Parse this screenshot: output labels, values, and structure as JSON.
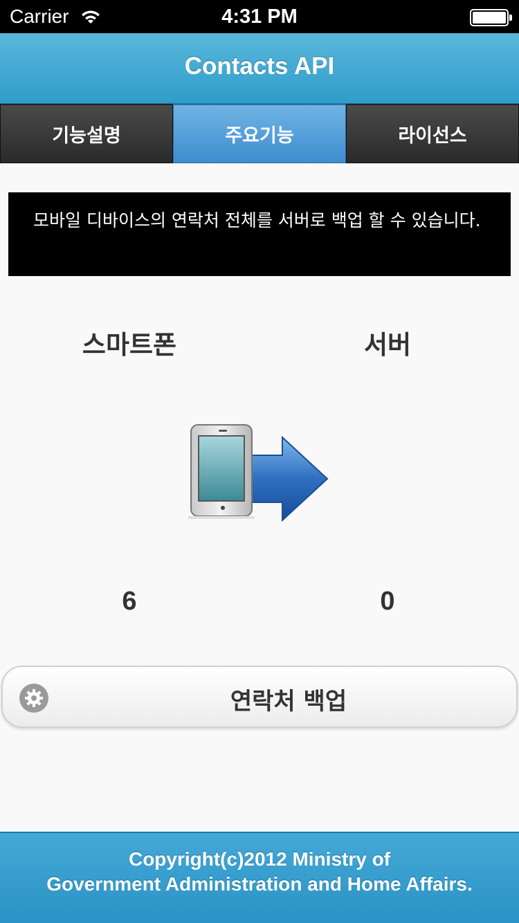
{
  "status_bar": {
    "carrier": "Carrier",
    "time": "4:31 PM",
    "icons": [
      "wifi-icon",
      "battery-icon"
    ]
  },
  "header": {
    "title": "Contacts API"
  },
  "tabs": [
    {
      "label": "기능설명",
      "active": false
    },
    {
      "label": "주요기능",
      "active": true
    },
    {
      "label": "라이선스",
      "active": false
    }
  ],
  "description": "모바일 디바이스의 연락처 전체를 서버로 백업 할 수 있습니다.",
  "columns": {
    "left_label": "스마트폰",
    "right_label": "서버",
    "left_count": "6",
    "right_count": "0"
  },
  "transfer_icons": [
    "smartphone-icon",
    "arrow-right-icon"
  ],
  "backup_button": {
    "label": "연락처 백업",
    "icon": "gear-icon"
  },
  "footer": {
    "line1": "Copyright(c)2012 Ministry of",
    "line2": "Government Administration and Home Affairs."
  },
  "colors": {
    "header_blue": "#3aa6d1",
    "tab_active": "#4f9dd8",
    "tab_inactive": "#333333",
    "footer_blue": "#3aa0cf",
    "background": "#f9f9f9"
  }
}
